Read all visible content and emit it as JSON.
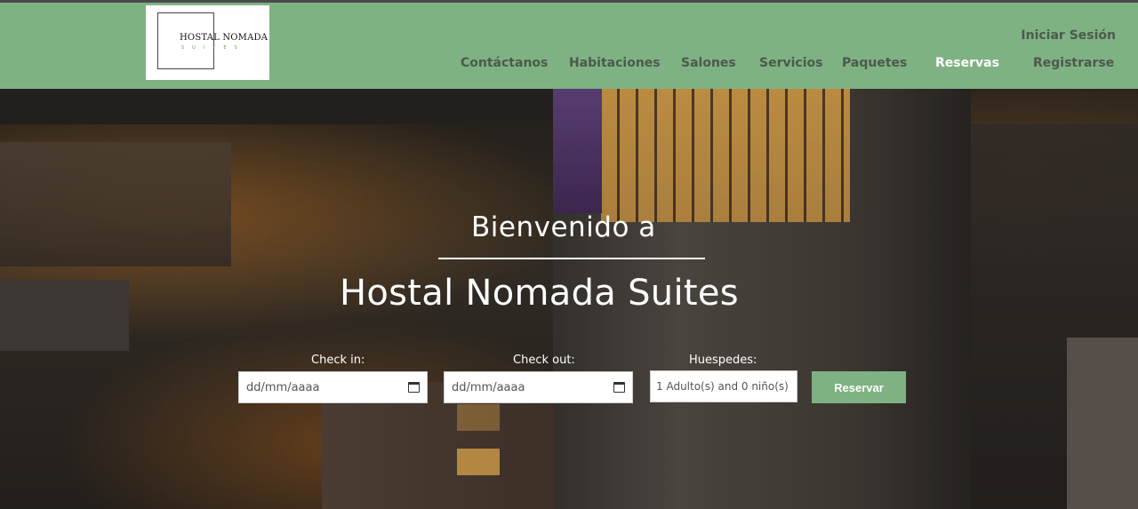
{
  "logo": {
    "title": "HOSTAL NOMADA",
    "subtitle": "SUITES"
  },
  "nav": {
    "login": "Iniciar Sesión",
    "items": [
      {
        "label": "Contáctanos"
      },
      {
        "label": "Habitaciones"
      },
      {
        "label": "Salones"
      },
      {
        "label": "Servicios"
      },
      {
        "label": "Paquetes"
      },
      {
        "label": "Reservas",
        "active": true
      },
      {
        "label": "Registrarse"
      }
    ]
  },
  "hero": {
    "welcome": "Bienvenido a",
    "title": "Hostal Nomada Suites"
  },
  "booking": {
    "checkin_label": "Check in:",
    "checkin_value": "dd/mm/aaaa",
    "checkout_label": "Check out:",
    "checkout_value": "dd/mm/aaaa",
    "guests_label": "Huespedes:",
    "guests_value": "1 Adulto(s) and 0 niño(s)",
    "reserve_button": "Reservar"
  },
  "colors": {
    "navbar": "#7fb283",
    "nav_text": "#4b5a4c",
    "nav_active": "#ffffff",
    "button": "#7fb283"
  }
}
